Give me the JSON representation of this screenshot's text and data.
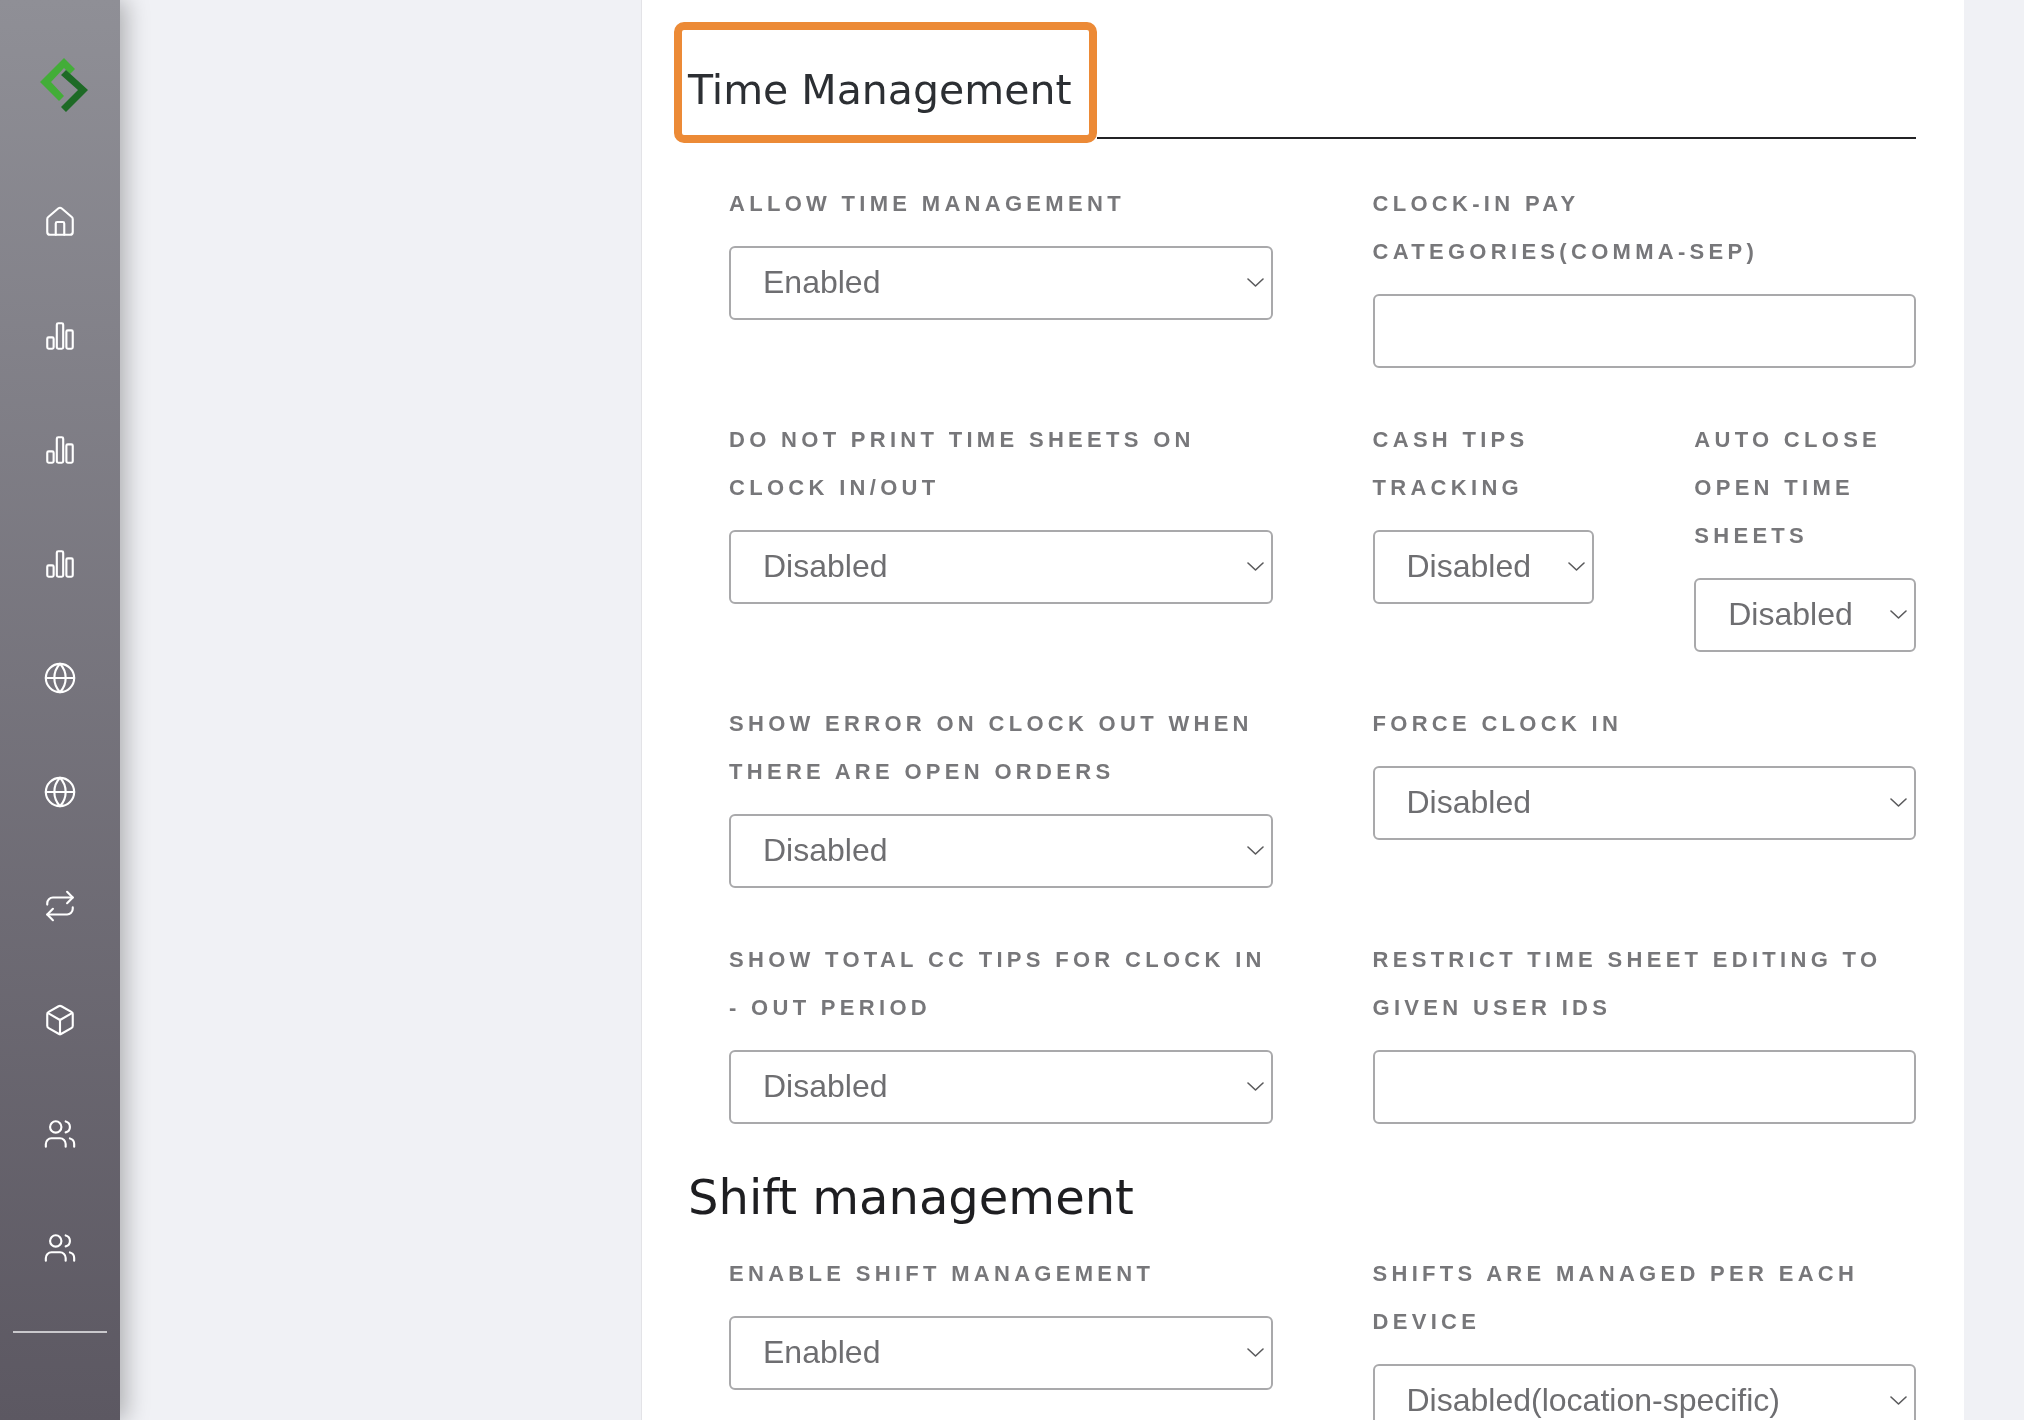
{
  "sections": [
    {
      "title": "Time Management",
      "kind": "underlined",
      "highlighted": true,
      "rows": [
        {
          "fields": [
            {
              "kind": "select",
              "label": "ALLOW TIME MANAGEMENT",
              "value": "Enabled"
            },
            {
              "kind": "text",
              "label": "CLOCK-IN PAY CATEGORIES(COMMA-SEP)"
            }
          ]
        },
        {
          "fields": [
            {
              "kind": "select",
              "label": "DO NOT PRINT TIME SHEETS ON CLOCK IN/OUT",
              "value": "Disabled"
            },
            {
              "kind": "group",
              "fields": [
                {
                  "kind": "select",
                  "label": "CASH TIPS TRACKING",
                  "value": "Disabled"
                },
                {
                  "kind": "select",
                  "label": "AUTO CLOSE OPEN TIME SHEETS",
                  "value": "Disabled"
                }
              ]
            }
          ]
        },
        {
          "fields": [
            {
              "kind": "select",
              "label": "SHOW ERROR ON CLOCK OUT WHEN THERE ARE OPEN ORDERS",
              "value": "Disabled"
            },
            {
              "kind": "select",
              "label": "FORCE CLOCK IN",
              "value": "Disabled"
            }
          ]
        },
        {
          "fields": [
            {
              "kind": "select",
              "label": "SHOW TOTAL CC TIPS FOR CLOCK IN - OUT PERIOD",
              "value": "Disabled"
            },
            {
              "kind": "text",
              "label": "RESTRICT TIME SHEET EDITING TO GIVEN USER IDS"
            }
          ]
        }
      ]
    },
    {
      "title": "Shift management",
      "kind": "plain",
      "highlighted": false,
      "rows": [
        {
          "fields": [
            {
              "kind": "select",
              "label": "ENABLE SHIFT MANAGEMENT",
              "value": "Enabled"
            },
            {
              "kind": "select",
              "label": "SHIFTS ARE MANAGED PER EACH DEVICE",
              "value": "Disabled(location-specific)"
            }
          ]
        }
      ]
    }
  ]
}
